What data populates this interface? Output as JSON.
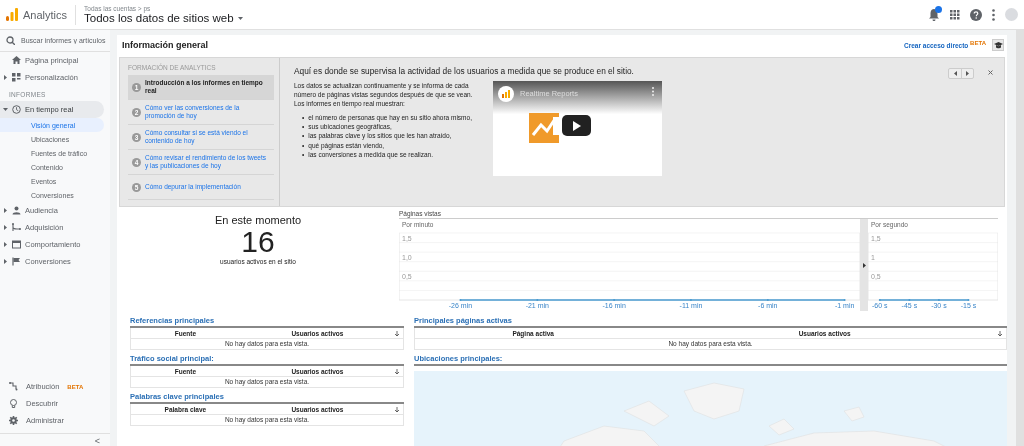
{
  "topbar": {
    "product": "Analytics",
    "breadcrumb": "Todas las cuentas > ps",
    "view": "Todos los datos de sitios web",
    "notifications": true
  },
  "sidebar": {
    "search": {
      "placeholder": "Buscar informes y artículos"
    },
    "home": {
      "label": "Página principal"
    },
    "customization": {
      "label": "Personalización",
      "expanded": false
    },
    "section_label": "INFORMES",
    "reports": [
      {
        "label": "En tiempo real",
        "expanded": true,
        "children": [
          {
            "label": "Visión general",
            "selected": true
          },
          {
            "label": "Ubicaciones",
            "selected": false
          },
          {
            "label": "Fuentes de tráfico",
            "selected": false
          },
          {
            "label": "Contenido",
            "selected": false
          },
          {
            "label": "Eventos",
            "selected": false
          },
          {
            "label": "Conversiones",
            "selected": false
          }
        ]
      },
      {
        "label": "Audiencia",
        "expanded": false
      },
      {
        "label": "Adquisición",
        "expanded": false
      },
      {
        "label": "Comportamiento",
        "expanded": false
      },
      {
        "label": "Conversiones",
        "expanded": false
      }
    ],
    "footer": [
      {
        "label": "Atribución",
        "badge": "BETA"
      },
      {
        "label": "Descubrir"
      },
      {
        "label": "Administrar"
      }
    ],
    "collapse": "<"
  },
  "page": {
    "title": "Información general",
    "shortcut": {
      "label": "Crear acceso directo",
      "badge": "BETA"
    }
  },
  "training": {
    "heading": "FORMACIÓN DE ANALYTICS",
    "steps": [
      {
        "number": "1",
        "label": "Introducción a los informes en tiempo real",
        "selected": true
      },
      {
        "number": "2",
        "label": "Cómo ver las conversiones de la promoción de hoy",
        "selected": false
      },
      {
        "number": "3",
        "label": "Cómo consultar si se está viendo el contenido de hoy",
        "selected": false
      },
      {
        "number": "4",
        "label": "Cómo revisar el rendimiento de los tweets y las publicaciones de hoy",
        "selected": false
      },
      {
        "number": "5",
        "label": "Cómo depurar la implementación",
        "selected": false
      }
    ],
    "title": "Aquí es donde se supervisa la actividad de los usuarios a medida que se produce en el sitio.",
    "intro": "Los datos se actualizan continuamente y se informa de cada número de páginas vistas segundos después de que se vean. Los informes en tiempo real muestran:",
    "bullets": [
      {
        "marker": "•",
        "text": "el número de personas que hay en su sitio ahora mismo,"
      },
      {
        "marker": "•",
        "text": "sus ubicaciones geográficas,"
      },
      {
        "marker": "•",
        "text": "las palabras clave y los sitios que les han atraído,"
      },
      {
        "marker": "•",
        "text": "qué páginas están viendo,"
      },
      {
        "marker": "•",
        "text": "las conversiones a medida que se realizan."
      }
    ],
    "video": {
      "title": "Realtime Reports",
      "kind": "picture"
    }
  },
  "realtime": {
    "heading": "En este momento",
    "count": "16",
    "caption": "usuarios activos en el sitio",
    "pageviews": {
      "title": "Páginas vistas",
      "per_minute": {
        "label": "Por minuto",
        "chart_data": {
          "type": "line",
          "grid": true,
          "x": [
            -26,
            -21,
            -16,
            -11,
            -6,
            -1
          ],
          "xlim": [
            -30,
            0
          ],
          "ylim": [
            0,
            1.75
          ],
          "xticks": [
            {
              "value": -26,
              "label": "-26 min"
            },
            {
              "value": -21,
              "label": "-21 min"
            },
            {
              "value": -16,
              "label": "-16 min"
            },
            {
              "value": -11,
              "label": "-11 min"
            },
            {
              "value": -6,
              "label": "-6 min"
            },
            {
              "value": -1,
              "label": "-1 min"
            }
          ],
          "yticks": [
            {
              "value": 0.5,
              "label": "0,5"
            },
            {
              "value": 1,
              "label": "1,0"
            },
            {
              "value": 1.5,
              "label": "1,5"
            }
          ],
          "series": [
            {
              "color": "#4a9bd0",
              "values": [
                0,
                0,
                0,
                0,
                0,
                0
              ]
            }
          ]
        }
      },
      "per_second": {
        "label": "Por segundo",
        "chart_data": {
          "type": "line",
          "grid": true,
          "x": [
            -60,
            -45,
            -30,
            -15
          ],
          "xlim": [
            -66,
            0
          ],
          "ylim": [
            0,
            1.75
          ],
          "xticks": [
            {
              "value": -60,
              "label": "-60 s"
            },
            {
              "value": -45,
              "label": "-45 s"
            },
            {
              "value": -30,
              "label": "-30 s"
            },
            {
              "value": -15,
              "label": "-15 s"
            }
          ],
          "yticks": [
            {
              "value": 0.5,
              "label": "0,5"
            },
            {
              "value": 1,
              "label": "1"
            },
            {
              "value": 1.5,
              "label": "1,5"
            }
          ],
          "series": [
            {
              "color": "#4a9bd0",
              "values": [
                0,
                0,
                0,
                0
              ]
            }
          ]
        }
      }
    }
  },
  "tables_left": [
    {
      "title": "Referencias principales",
      "columns": [
        "Fuente",
        "Usuarios activos"
      ],
      "empty": "No hay datos para esta vista."
    },
    {
      "title": "Tráfico social principal:",
      "columns": [
        "Fuente",
        "Usuarios activos"
      ],
      "empty": "No hay datos para esta vista."
    },
    {
      "title": "Palabras clave principales",
      "columns": [
        "Palabra clave",
        "Usuarios activos"
      ],
      "empty": "No hay datos para esta vista."
    }
  ],
  "tables_right": [
    {
      "title": "Principales páginas activas",
      "columns": [
        "Página activa",
        "Usuarios activos"
      ],
      "empty": "No hay datos para esta vista."
    }
  ],
  "locations": {
    "title": "Ubicaciones principales:"
  }
}
